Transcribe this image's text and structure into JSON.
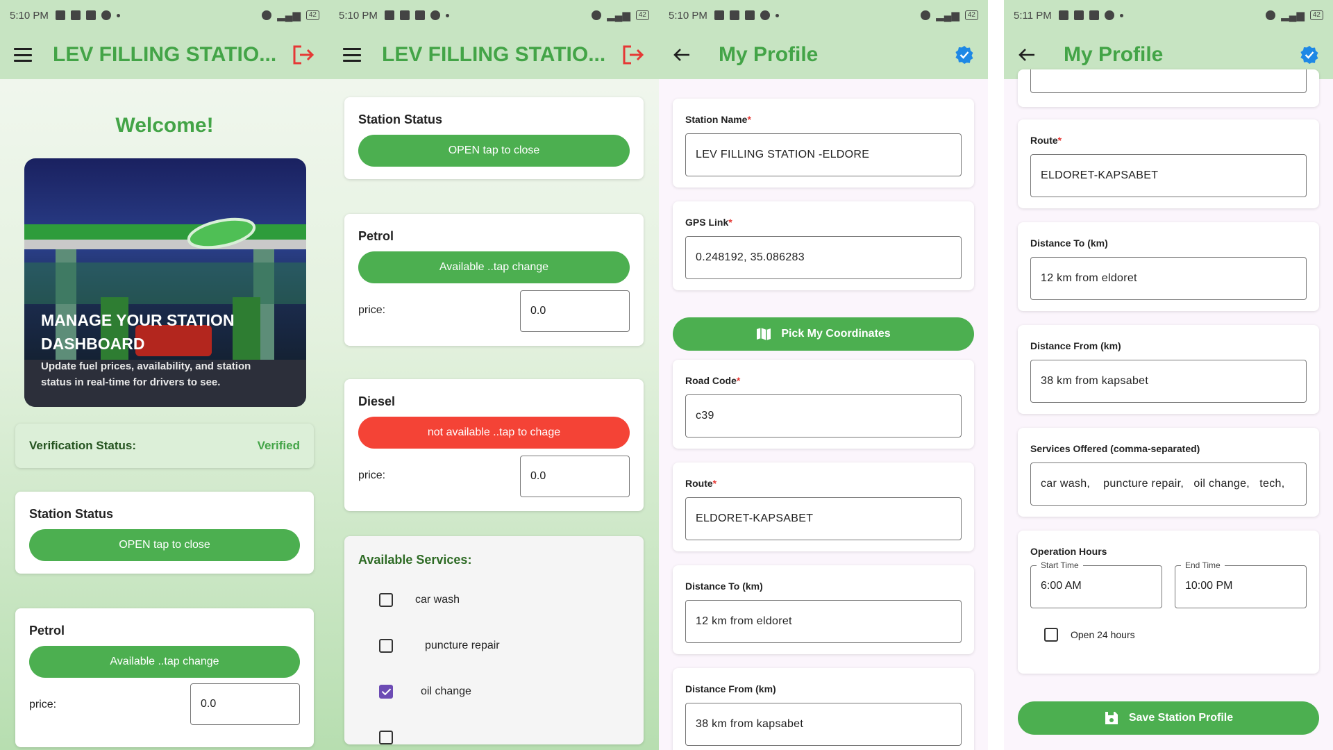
{
  "status": {
    "time1": "5:10 PM",
    "time2": "5:10 PM",
    "time3": "5:10 PM",
    "time4": "5:11 PM",
    "battery": "42"
  },
  "dashboard": {
    "app_title": "LEV FILLING STATIO...",
    "welcome": "Welcome!",
    "hero_title": "MANAGE YOUR STATION DASHBOARD",
    "hero_subtitle": "Update fuel prices, availability, and station status in real-time for drivers to see.",
    "verification_label": "Verification Status:",
    "verification_value": "Verified",
    "station_status_title": "Station Status",
    "station_status_button": "OPEN tap to close",
    "petrol_title": "Petrol",
    "petrol_button": "Available ..tap change",
    "price_label": "price:",
    "petrol_price": "0.0"
  },
  "fuel": {
    "station_status_title": "Station Status",
    "station_status_button": "OPEN tap to close",
    "petrol_title": "Petrol",
    "petrol_button": "Available ..tap change",
    "price_label": "price:",
    "petrol_price": "0.0",
    "diesel_title": "Diesel",
    "diesel_button": "not available ..tap to chage",
    "diesel_price": "0.0",
    "services_title": "Available Services:",
    "services": [
      {
        "label": "car wash",
        "checked": false
      },
      {
        "label": "puncture repair",
        "checked": false
      },
      {
        "label": "oil change",
        "checked": true
      }
    ]
  },
  "profile": {
    "title": "My Profile",
    "station_name_label": "Station Name",
    "station_name": "LEV FILLING STATION -ELDORE",
    "gps_label": "GPS Link",
    "gps_value": "0.248192, 35.086283",
    "pick_button": "Pick My Coordinates",
    "road_code_label": "Road Code",
    "road_code": "c39",
    "route_label": "Route",
    "route": "ELDORET-KAPSABET",
    "distance_to_label": "Distance To (km)",
    "distance_to": "12 km from eldoret",
    "distance_from_label": "Distance From (km)",
    "distance_from": "38 km from kapsabet"
  },
  "profile2": {
    "title": "My Profile",
    "route_label": "Route",
    "route": "ELDORET-KAPSABET",
    "distance_to_label": "Distance To (km)",
    "distance_to": "12 km from eldoret",
    "distance_from_label": "Distance From (km)",
    "distance_from": "38 km from kapsabet",
    "services_label": "Services Offered (comma-separated)",
    "services_value": "car wash,    puncture repair,   oil change,   tech,",
    "hours_label": "Operation Hours",
    "start_label": "Start Time",
    "start_value": "6:00 AM",
    "end_label": "End Time",
    "end_value": "10:00 PM",
    "open24_label": "Open 24 hours",
    "save_button": "Save Station Profile"
  },
  "colors": {
    "brand_green": "#43a447",
    "button_green": "#4caf50",
    "alert_red": "#f44336",
    "appbar": "#c7e4c2"
  }
}
